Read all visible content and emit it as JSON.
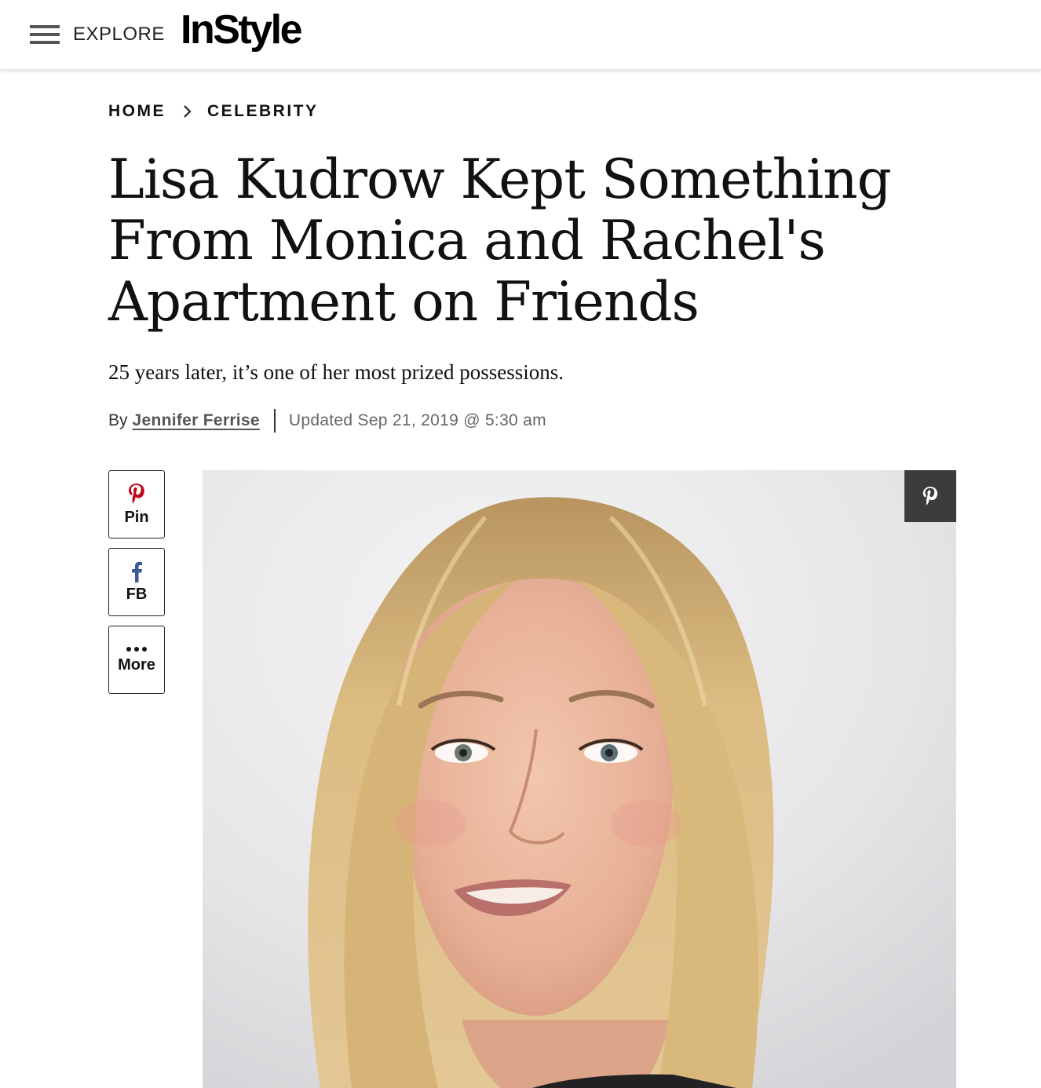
{
  "header": {
    "explore_label": "EXPLORE",
    "logo_text": "InStyle"
  },
  "breadcrumb": {
    "items": [
      "HOME",
      "CELEBRITY"
    ]
  },
  "article": {
    "title": "Lisa Kudrow Kept Something From Monica and Rachel's Apartment on Friends",
    "dek": "25 years later, it’s one of her most prized possessions.",
    "byline_prefix": "By",
    "author": "Jennifer Ferrise",
    "updated": "Updated Sep 21, 2019 @ 5:30 am"
  },
  "share": {
    "pin_label": "Pin",
    "fb_label": "FB",
    "more_label": "More"
  },
  "icons": {
    "menu": "hamburger-icon",
    "breadcrumb_separator": "chevron-right-icon",
    "pinterest": "pinterest-icon",
    "facebook": "facebook-icon",
    "more": "ellipsis-icon"
  },
  "colors": {
    "pinterest": "#bd081c",
    "facebook": "#3b5998",
    "pin_overlay_bg": "#3c3c3c",
    "hair": "#d9b679",
    "skin": "#e8b59c"
  }
}
